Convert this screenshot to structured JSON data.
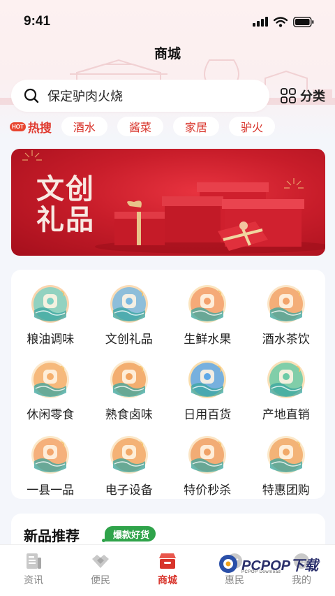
{
  "status_bar": {
    "time": "9:41"
  },
  "header": {
    "title": "商城"
  },
  "search": {
    "placeholder": "保定驴肉火烧",
    "category_label": "分类"
  },
  "hot_search": {
    "badge": "HOT",
    "label": "热搜",
    "tags": [
      "酒水",
      "酱菜",
      "家居",
      "驴火"
    ]
  },
  "banner": {
    "title_line1": "文创",
    "title_line2": "礼品"
  },
  "categories": [
    {
      "label": "粮油调味",
      "icon": "grain-oil-icon"
    },
    {
      "label": "文创礼品",
      "icon": "lion-gift-icon"
    },
    {
      "label": "生鲜水果",
      "icon": "fish-fruit-icon"
    },
    {
      "label": "酒水茶饮",
      "icon": "wine-jar-icon"
    },
    {
      "label": "休闲零食",
      "icon": "snack-icon"
    },
    {
      "label": "熟食卤味",
      "icon": "cooked-food-icon"
    },
    {
      "label": "日用百货",
      "icon": "giftbox-icon"
    },
    {
      "label": "产地直销",
      "icon": "lotus-icon"
    },
    {
      "label": "一县一品",
      "icon": "county-city-icon"
    },
    {
      "label": "电子设备",
      "icon": "phone-device-icon"
    },
    {
      "label": "特价秒杀",
      "icon": "flash-sale-icon"
    },
    {
      "label": "特惠团购",
      "icon": "shopping-bag-icon"
    }
  ],
  "new_products": {
    "title": "新品推荐",
    "badge": "爆款好货"
  },
  "tab_bar": {
    "tabs": [
      {
        "label": "资讯",
        "icon": "news-icon",
        "active": false
      },
      {
        "label": "便民",
        "icon": "handshake-icon",
        "active": false
      },
      {
        "label": "商城",
        "icon": "shop-icon",
        "active": true
      },
      {
        "label": "惠民",
        "icon": "benefit-icon",
        "active": false
      },
      {
        "label": "我的",
        "icon": "profile-icon",
        "active": false
      }
    ]
  },
  "watermark": {
    "text": "PCPOP下载",
    "sub": "PCPOP Download"
  },
  "colors": {
    "brand_red": "#d8342b",
    "green_badge": "#2fa34a"
  }
}
